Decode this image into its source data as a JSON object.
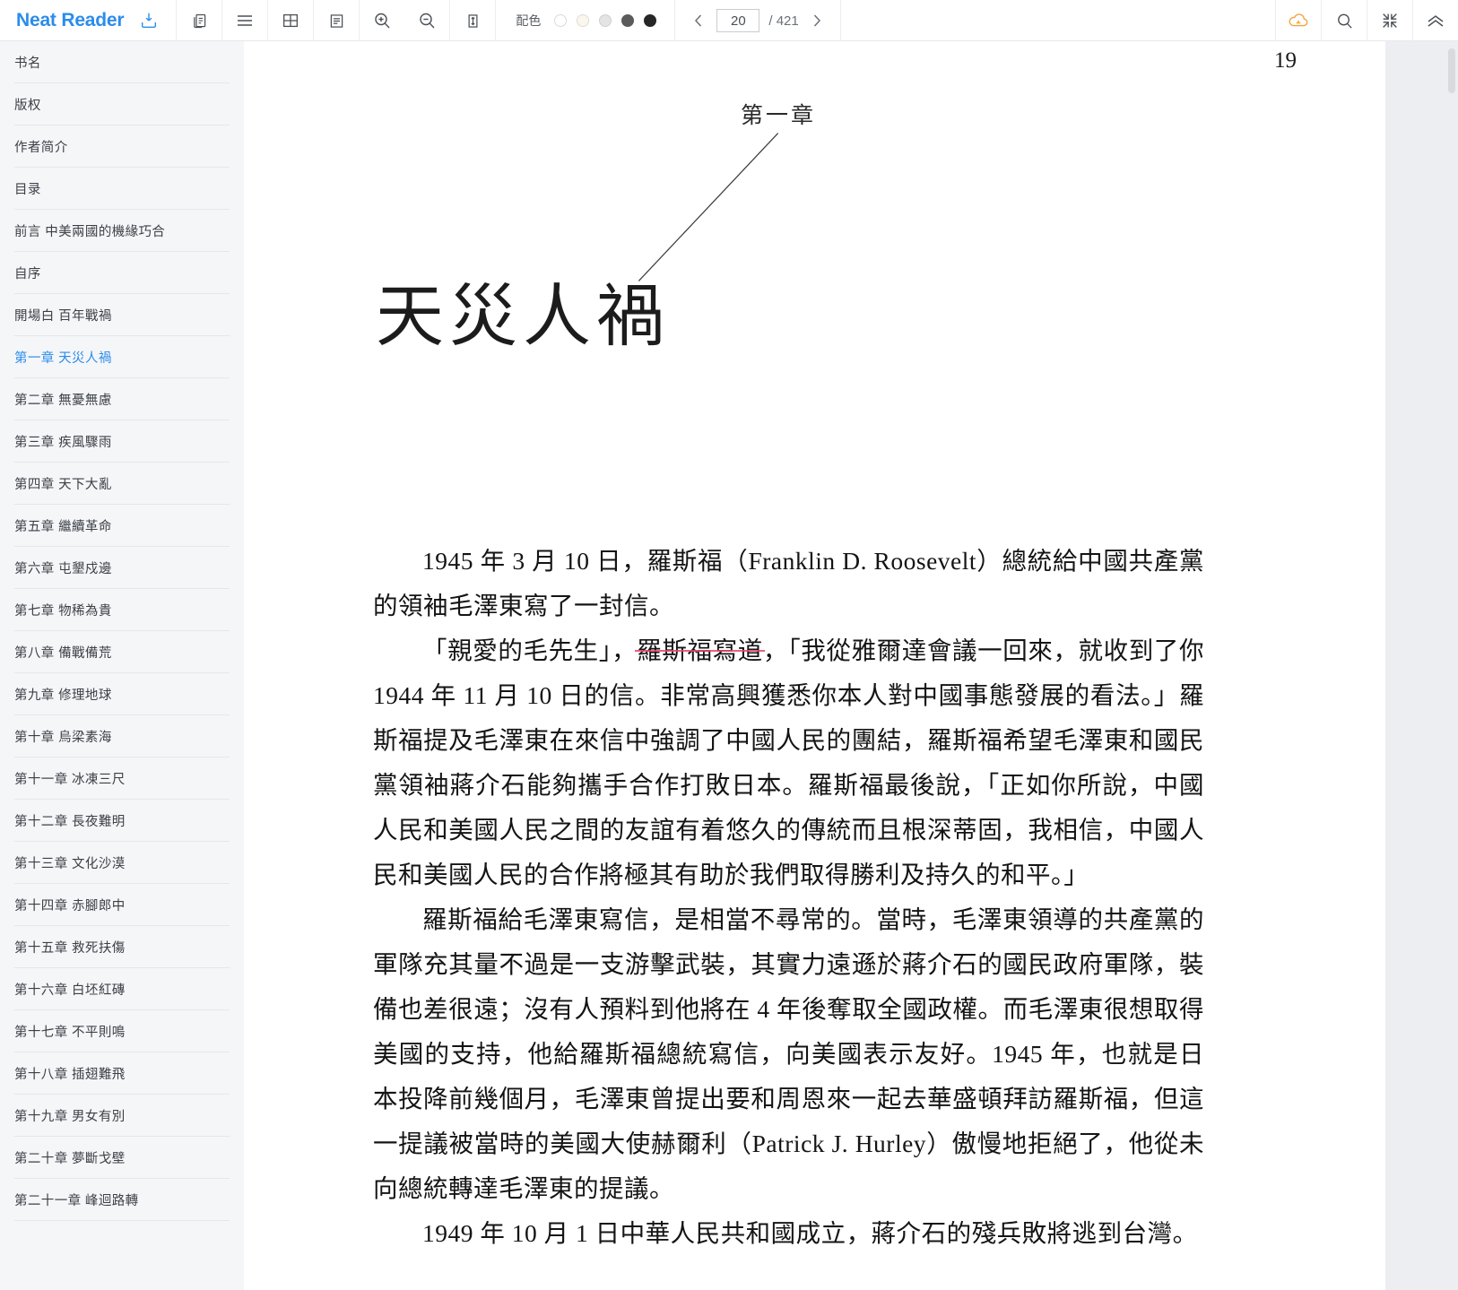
{
  "app": {
    "brand": "Neat Reader"
  },
  "toolbar": {
    "icons": {
      "save_book": "download-book-icon",
      "copy": "copy-icon",
      "menu": "list-menu-icon",
      "grid": "grid-layout-icon",
      "single_page": "single-page-icon",
      "zoom_in": "zoom-in-icon",
      "zoom_out": "zoom-out-icon",
      "fit_height": "fit-height-icon",
      "cloud_sync": "cloud-sync-icon",
      "search": "search-icon",
      "compress": "compress-icon",
      "collapse_up": "chevron-double-up-icon"
    },
    "theme": {
      "label": "配色",
      "swatches": [
        "#ffffff",
        "#fbf7ee",
        "#e4e4e4",
        "#5b5b5b",
        "#262626"
      ],
      "selected_index": 0
    },
    "pager": {
      "prev": "‹",
      "next": "›",
      "current_page": "20",
      "total_label": "/ 421",
      "total_pages": "421"
    }
  },
  "sidebar": {
    "items": [
      {
        "label": "书名",
        "active": false
      },
      {
        "label": "版权",
        "active": false
      },
      {
        "label": "作者简介",
        "active": false
      },
      {
        "label": "目录",
        "active": false
      },
      {
        "label": "前言 中美兩國的機緣巧合",
        "active": false
      },
      {
        "label": "自序",
        "active": false
      },
      {
        "label": "開場白 百年戰禍",
        "active": false
      },
      {
        "label": "第一章 天災人禍",
        "active": true
      },
      {
        "label": "第二章 無憂無慮",
        "active": false
      },
      {
        "label": "第三章 疾風驟雨",
        "active": false
      },
      {
        "label": "第四章 天下大亂",
        "active": false
      },
      {
        "label": "第五章 繼續革命",
        "active": false
      },
      {
        "label": "第六章 屯墾戍邊",
        "active": false
      },
      {
        "label": "第七章 物稀為貴",
        "active": false
      },
      {
        "label": "第八章 備戰備荒",
        "active": false
      },
      {
        "label": "第九章 修理地球",
        "active": false
      },
      {
        "label": "第十章 烏梁素海",
        "active": false
      },
      {
        "label": "第十一章 冰凍三尺",
        "active": false
      },
      {
        "label": "第十二章 長夜難明",
        "active": false
      },
      {
        "label": "第十三章 文化沙漠",
        "active": false
      },
      {
        "label": "第十四章 赤腳郎中",
        "active": false
      },
      {
        "label": "第十五章 救死扶傷",
        "active": false
      },
      {
        "label": "第十六章 白坯紅磚",
        "active": false
      },
      {
        "label": "第十七章 不平則鳴",
        "active": false
      },
      {
        "label": "第十八章 插翅難飛",
        "active": false
      },
      {
        "label": "第十九章 男女有別",
        "active": false
      },
      {
        "label": "第二十章 夢斷戈壁",
        "active": false
      },
      {
        "label": "第二十一章 峰迴路轉",
        "active": false
      }
    ]
  },
  "page": {
    "folio": "19",
    "chapter_number": "第一章",
    "chapter_title": "天災人禍",
    "paragraphs": [
      "1945 年 3 月 10 日，羅斯福（Franklin D. Roosevelt）總統給中國共產黨的領袖毛澤東寫了一封信。",
      "「親愛的毛先生」，羅斯福寫道，「我從雅爾達會議一回來，就收到了你 1944 年 11 月 10 日的信。非常高興獲悉你本人對中國事態發展的看法。」羅斯福提及毛澤東在來信中強調了中國人民的團結，羅斯福希望毛澤東和國民黨領袖蔣介石能夠攜手合作打敗日本。羅斯福最後說，「正如你所說，中國人民和美國人民之間的友誼有着悠久的傳統而且根深蒂固，我相信，中國人民和美國人民的合作將極其有助於我們取得勝利及持久的和平。」",
      "羅斯福給毛澤東寫信，是相當不尋常的。當時，毛澤東領導的共產黨的軍隊充其量不過是一支游擊武裝，其實力遠遜於蔣介石的國民政府軍隊，裝備也差很遠；沒有人預料到他將在 4 年後奪取全國政權。而毛澤東很想取得美國的支持，他給羅斯福總統寫信，向美國表示友好。1945 年，也就是日本投降前幾個月，毛澤東曾提出要和周恩來一起去華盛頓拜訪羅斯福，但這一提議被當時的美國大使赫爾利（Patrick J. Hurley）傲慢地拒絕了，他從未向總統轉達毛澤東的提議。",
      "1949 年 10 月 1 日中華人民共和國成立，蔣介石的殘兵敗將逃到台灣。"
    ],
    "annotation": {
      "text": "羅斯福寫道",
      "color": "#e3456a",
      "type": "red-underline"
    }
  }
}
